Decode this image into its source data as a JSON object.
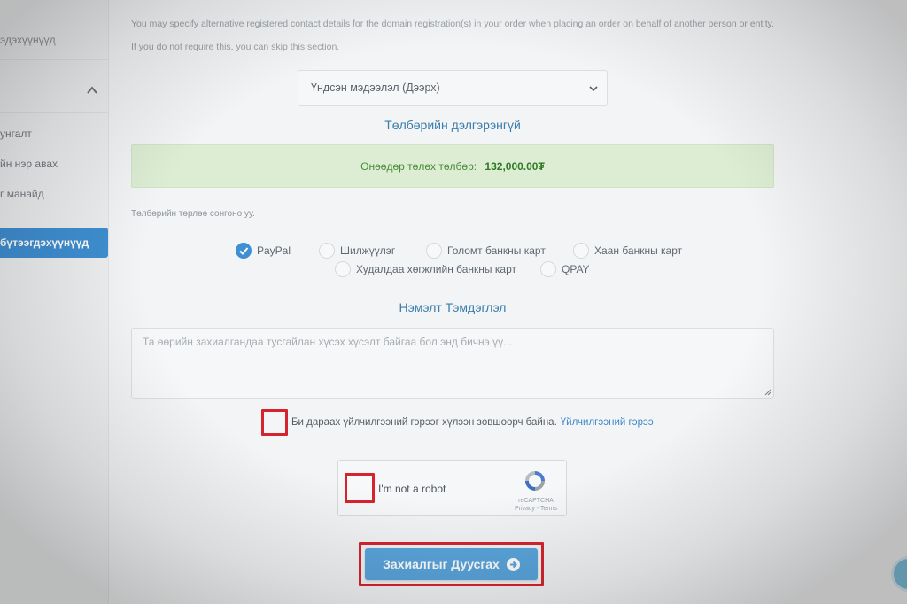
{
  "sidebar": {
    "top_item": "эдэхүүнүүд",
    "items": [
      {
        "label": "унгалт"
      },
      {
        "label": "йн нэр авах"
      },
      {
        "label": "г манайд"
      }
    ],
    "active_item": "бүтээгдэхүүнүүд",
    "chevron_icon": "chevron-up-icon"
  },
  "intro": {
    "text": "You may specify alternative registered contact details for the domain registration(s) in your order when placing an order on behalf of another person or entity. If you do not require this, you can skip this section."
  },
  "address_select": {
    "value": "Үндсэн мэдээлэл (Дээрх)",
    "icon": "chevron-down-icon"
  },
  "payment": {
    "title": "Төлбөрийн дэлгэрэнгүй",
    "due_label": "Өнөөдөр төлөх төлбөр:",
    "due_amount": "132,000.00₮",
    "hint": "Төлбөрийн төрлөө сонгоно уу.",
    "methods": [
      {
        "label": "PayPal",
        "selected": true
      },
      {
        "label": "Шилжүүлэг",
        "selected": false
      },
      {
        "label": "Голомт банкны карт",
        "selected": false
      },
      {
        "label": "Хаан банкны карт",
        "selected": false
      },
      {
        "label": "Худалдаа хөгжлийн банкны карт",
        "selected": false
      },
      {
        "label": "QPAY",
        "selected": false
      }
    ]
  },
  "notes": {
    "title": "Нэмэлт Тэмдэглэл",
    "placeholder": "Та өөрийн захиалгандаа тусгайлан хүсэх хүсэлт байгаа бол энд бичнэ үү..."
  },
  "tos": {
    "text": "Би дараах үйлчилгээний гэрээг хүлээн зөвшөөрч байна.",
    "link": "Үйлчилгээний гэрээ"
  },
  "recaptcha": {
    "label": "I'm not a robot",
    "brand": "reCAPTCHA",
    "links": "Privacy - Terms"
  },
  "submit": {
    "label": "Захиалгыг Дуусгах",
    "icon": "arrow-circle-right-icon"
  },
  "colors": {
    "accent": "#3f8fd2",
    "success_bg": "#dcedd3",
    "highlight_red": "#d6242f"
  }
}
